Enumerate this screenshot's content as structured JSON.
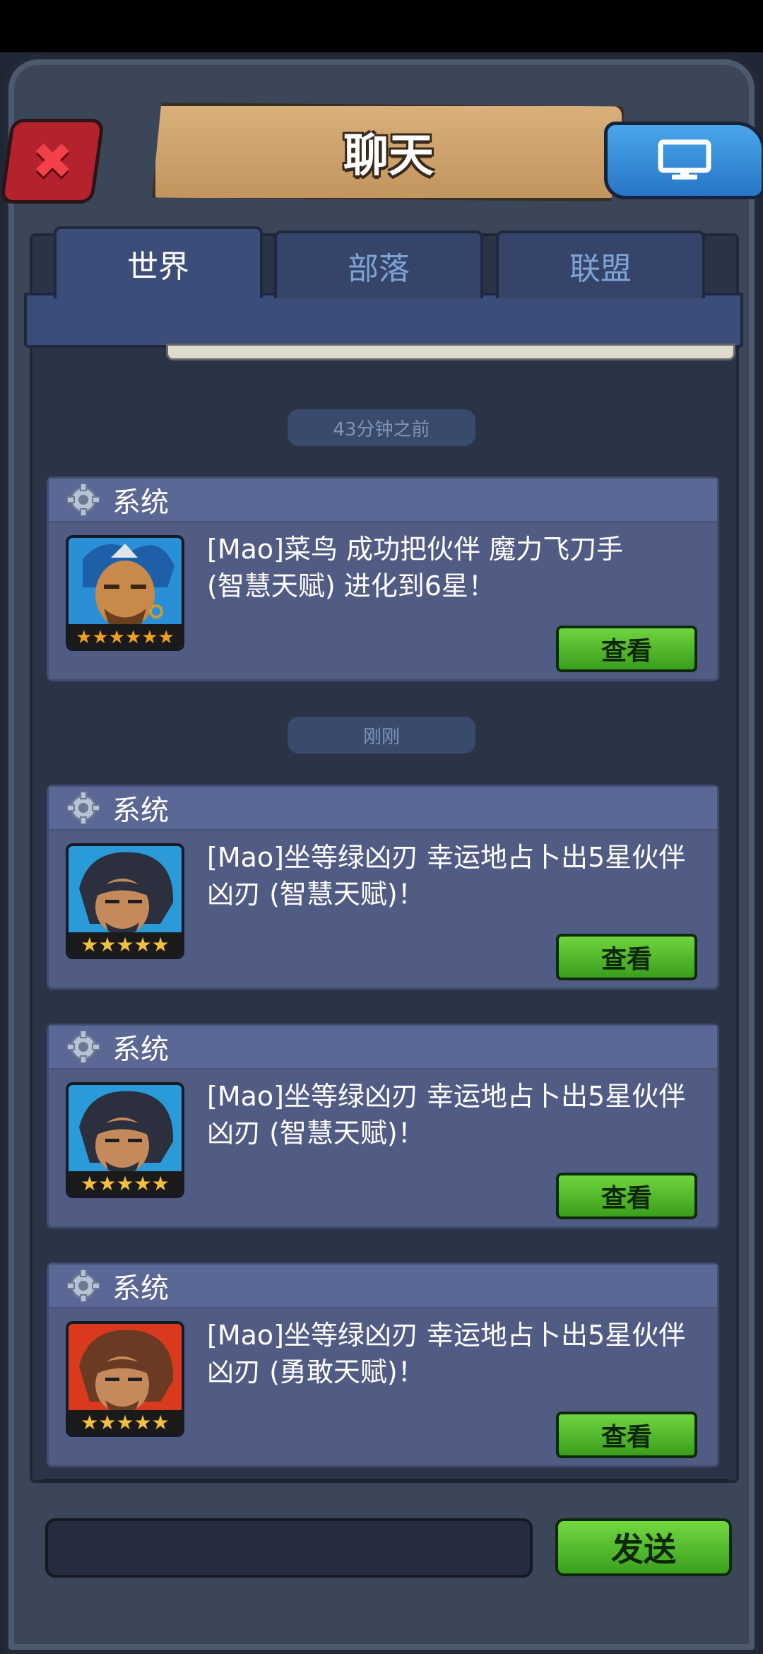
{
  "header": {
    "title": "聊天"
  },
  "tabs": [
    {
      "label": "世界",
      "active": true
    },
    {
      "label": "部落",
      "active": false
    },
    {
      "label": "联盟",
      "active": false
    }
  ],
  "time_labels": [
    "43分钟之前",
    "刚刚"
  ],
  "messages": [
    {
      "sender": "系统",
      "line1": "[Mao]菜鸟 成功把伙伴 魔力飞刀手",
      "line2": "(智慧天赋) 进化到6星！",
      "stars": 6,
      "portrait": "blue-hair-warrior",
      "button": "查看"
    },
    {
      "sender": "系统",
      "line1": "[Mao]坐等绿凶刃 幸运地占卜出5星伙伴",
      "line2": "凶刃 (智慧天赋)！",
      "stars": 5,
      "portrait": "blue-rogue",
      "button": "查看"
    },
    {
      "sender": "系统",
      "line1": "[Mao]坐等绿凶刃 幸运地占卜出5星伙伴",
      "line2": "凶刃 (智慧天赋)！",
      "stars": 5,
      "portrait": "blue-rogue",
      "button": "查看"
    },
    {
      "sender": "系统",
      "line1": "[Mao]坐等绿凶刃 幸运地占卜出5星伙伴",
      "line2": "凶刃 (勇敢天赋)！",
      "stars": 5,
      "portrait": "red-rogue",
      "button": "查看"
    }
  ],
  "footer": {
    "input_placeholder": "",
    "send_label": "发送"
  },
  "colors": {
    "accent_green": "#4cb82a",
    "panel": "#515c85",
    "close_red": "#b4232d",
    "screen_blue": "#2f86d6"
  }
}
